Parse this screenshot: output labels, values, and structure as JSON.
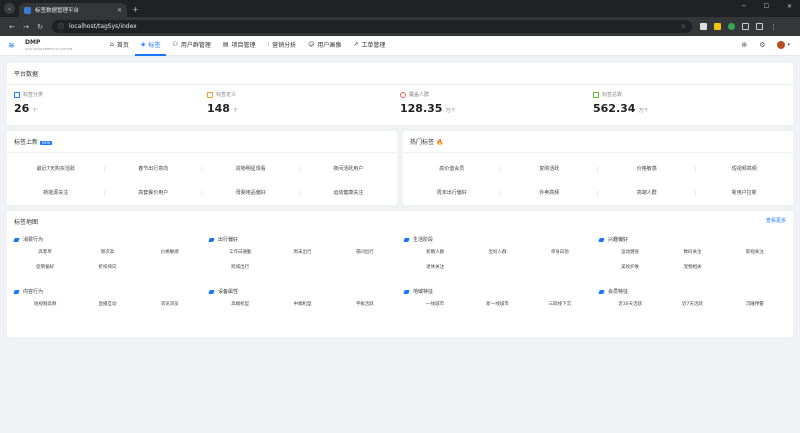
{
  "browser": {
    "tab_title": "标签数据管理平台",
    "url": "localhost/tagSys/index"
  },
  "app": {
    "logo_text": "DMP",
    "logo_sub": "DATA MANAGEMENT PLATFORM",
    "menu": [
      {
        "label": "首页",
        "icon": "home-icon"
      },
      {
        "label": "标签",
        "icon": "tag-icon"
      },
      {
        "label": "用户群管理",
        "icon": "users-icon"
      },
      {
        "label": "项目管理",
        "icon": "project-icon"
      },
      {
        "label": "营销分析",
        "icon": "chart-icon"
      },
      {
        "label": "用户画像",
        "icon": "profile-icon"
      },
      {
        "label": "工单管理",
        "icon": "wrench-icon"
      }
    ],
    "active_menu": "标签"
  },
  "platform": {
    "title": "平台数据",
    "stats": [
      {
        "label": "标签分类",
        "value": "26",
        "unit": "个",
        "color": "#1677ff"
      },
      {
        "label": "标签定义",
        "value": "148",
        "unit": "个",
        "color": "#f0a020"
      },
      {
        "label": "覆盖人群",
        "value": "128.35",
        "unit": "万个",
        "color": "#f5605a"
      },
      {
        "label": "标签总数",
        "value": "562.34",
        "unit": "万个",
        "color": "#52c41a"
      }
    ]
  },
  "new_tags": {
    "title": "标签上新",
    "badge": "NEW",
    "items": [
      "最近7天购买活跃",
      "春节出行意向",
      "造物明星观看",
      "夜间活跃用户",
      "新能源关注",
      "高套餐价用户",
      "母婴用品偏好",
      "运动健康关注"
    ]
  },
  "hot_tags": {
    "title": "热门标签",
    "items": [
      "高价值会员",
      "复购活跃",
      "价格敏感",
      "短视频高频",
      "周末出行偏好",
      "外卖高频",
      "高端人群",
      "新用户拉新"
    ]
  },
  "tag_map": {
    "title": "标签地图",
    "more": "查看更多",
    "groups": [
      {
        "title": "消费行为",
        "tags": [
          "高客单",
          "频次高",
          "价格敏感",
          "促销偏好",
          "折扣倾向"
        ]
      },
      {
        "title": "出行偏好",
        "tags": [
          "工作日通勤",
          "周末出行",
          "夜间出行",
          "跨城出行"
        ]
      },
      {
        "title": "生活阶段",
        "tags": [
          "新婚人群",
          "宝妈人群",
          "单身白领",
          "退休关注"
        ]
      },
      {
        "title": "兴趣偏好",
        "tags": [
          "运动健身",
          "数码关注",
          "影视关注",
          "美妆护肤",
          "宠物相关"
        ]
      },
      {
        "title": "内容行为",
        "tags": [
          "短视频高频",
          "直播互动",
          "资讯浏览"
        ]
      },
      {
        "title": "设备属性",
        "tags": [
          "高端机型",
          "中端机型",
          "平板活跃"
        ]
      },
      {
        "title": "地域特征",
        "tags": [
          "一线城市",
          "新一线城市",
          "三四线下沉"
        ]
      },
      {
        "title": "会员特征",
        "tags": [
          "近30天活跃",
          "近7天活跃",
          "沉睡预警"
        ]
      }
    ]
  }
}
